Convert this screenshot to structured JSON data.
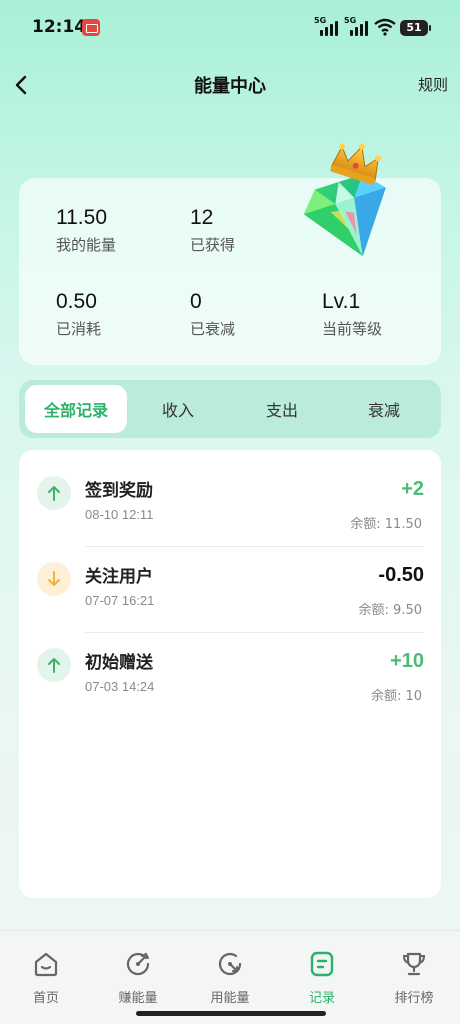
{
  "status_bar": {
    "time": "12:14",
    "network_1": "5G",
    "network_2": "5G",
    "battery": "51"
  },
  "nav": {
    "title": "能量中心",
    "rules": "规则"
  },
  "stats": [
    {
      "value": "11.50",
      "label": "我的能量"
    },
    {
      "value": "12",
      "label": "已获得"
    },
    {
      "value": "0.50",
      "label": "已消耗"
    },
    {
      "value": "0",
      "label": "已衰减"
    },
    {
      "value": "Lv.1",
      "label": "当前等级"
    }
  ],
  "tabs": [
    {
      "label": "全部记录",
      "active": true
    },
    {
      "label": "收入",
      "active": false
    },
    {
      "label": "支出",
      "active": false
    },
    {
      "label": "衰减",
      "active": false
    }
  ],
  "records": [
    {
      "title": "签到奖励",
      "time": "08-10 12:11",
      "amount": "+2",
      "balance": "余额: 11.50",
      "direction": "up"
    },
    {
      "title": "关注用户",
      "time": "07-07 16:21",
      "amount": "-0.50",
      "balance": "余额: 9.50",
      "direction": "down"
    },
    {
      "title": "初始赠送",
      "time": "07-03 14:24",
      "amount": "+10",
      "balance": "余额: 10",
      "direction": "up"
    }
  ],
  "bottom_nav": [
    {
      "label": "首页",
      "icon": "home-icon"
    },
    {
      "label": "赚能量",
      "icon": "earn-energy-icon"
    },
    {
      "label": "用能量",
      "icon": "use-energy-icon"
    },
    {
      "label": "记录",
      "icon": "records-icon",
      "active": true
    },
    {
      "label": "排行榜",
      "icon": "trophy-icon"
    }
  ],
  "colors": {
    "accent": "#2bb26a",
    "positive": "#4cbb73",
    "up_bg": "#e3f5ea",
    "down_bg": "#fdf0d7",
    "down_arrow": "#f2b233"
  }
}
